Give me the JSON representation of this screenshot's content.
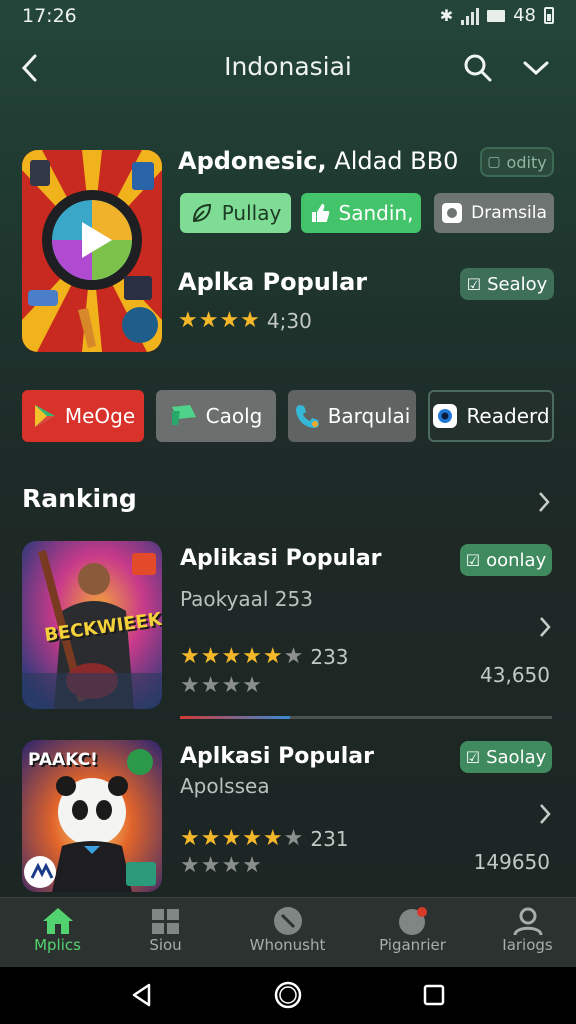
{
  "status": {
    "time": "17:26",
    "battery_text": "48"
  },
  "appbar": {
    "title": "Indonasiai"
  },
  "featured": {
    "title_bold": "Apdonesic,",
    "title_rest": " Aldad BB0",
    "chip_label": "odity",
    "buttons": [
      {
        "label": "Pullay",
        "icon": "leaf-icon"
      },
      {
        "label": "Sandin,",
        "icon": "thumb-icon"
      },
      {
        "label": "Dramsila",
        "icon": "camera-icon"
      }
    ],
    "subtitle": "Aplka Popular",
    "sub_chip": "Sealoy",
    "rating_text": "4;30",
    "rating_stars": 4
  },
  "categories": [
    {
      "label": "MeOge",
      "icon": "play-store-icon",
      "color": "#d8322a"
    },
    {
      "label": "Caolg",
      "icon": "flag-icon",
      "color": "#6b6f6e"
    },
    {
      "label": "Barqulai",
      "icon": "phone-icon",
      "color": "#5f6463"
    },
    {
      "label": "Readerd",
      "icon": "eye-icon",
      "color": "#23302c"
    }
  ],
  "ranking": {
    "title": "Ranking",
    "items": [
      {
        "title": "Aplikasi Popular",
        "subtitle": "Paokyaal 253",
        "chip": "oonlay",
        "rating_text": "233",
        "rating": 4.5,
        "count": "43,650",
        "art_text": "BECKWIEEK"
      },
      {
        "title": "Aplkasi Popular",
        "subtitle": "Apolssea",
        "chip": "Saolay",
        "rating_text": "231",
        "rating": 4.5,
        "count": "149650",
        "art_text": "PAAKC!"
      }
    ]
  },
  "bottom_nav": [
    {
      "label": "Mplics",
      "icon": "home-icon",
      "active": true
    },
    {
      "label": "Siou",
      "icon": "grid-icon",
      "active": false
    },
    {
      "label": "Whonusht",
      "icon": "search-circle-icon",
      "active": false
    },
    {
      "label": "Piganrier",
      "icon": "notification-icon",
      "active": false
    },
    {
      "label": "Iariogs",
      "icon": "person-icon",
      "active": false
    }
  ],
  "colors": {
    "accent": "#53d36f",
    "chip": "#3e6f59",
    "star": "#f5b82a"
  }
}
